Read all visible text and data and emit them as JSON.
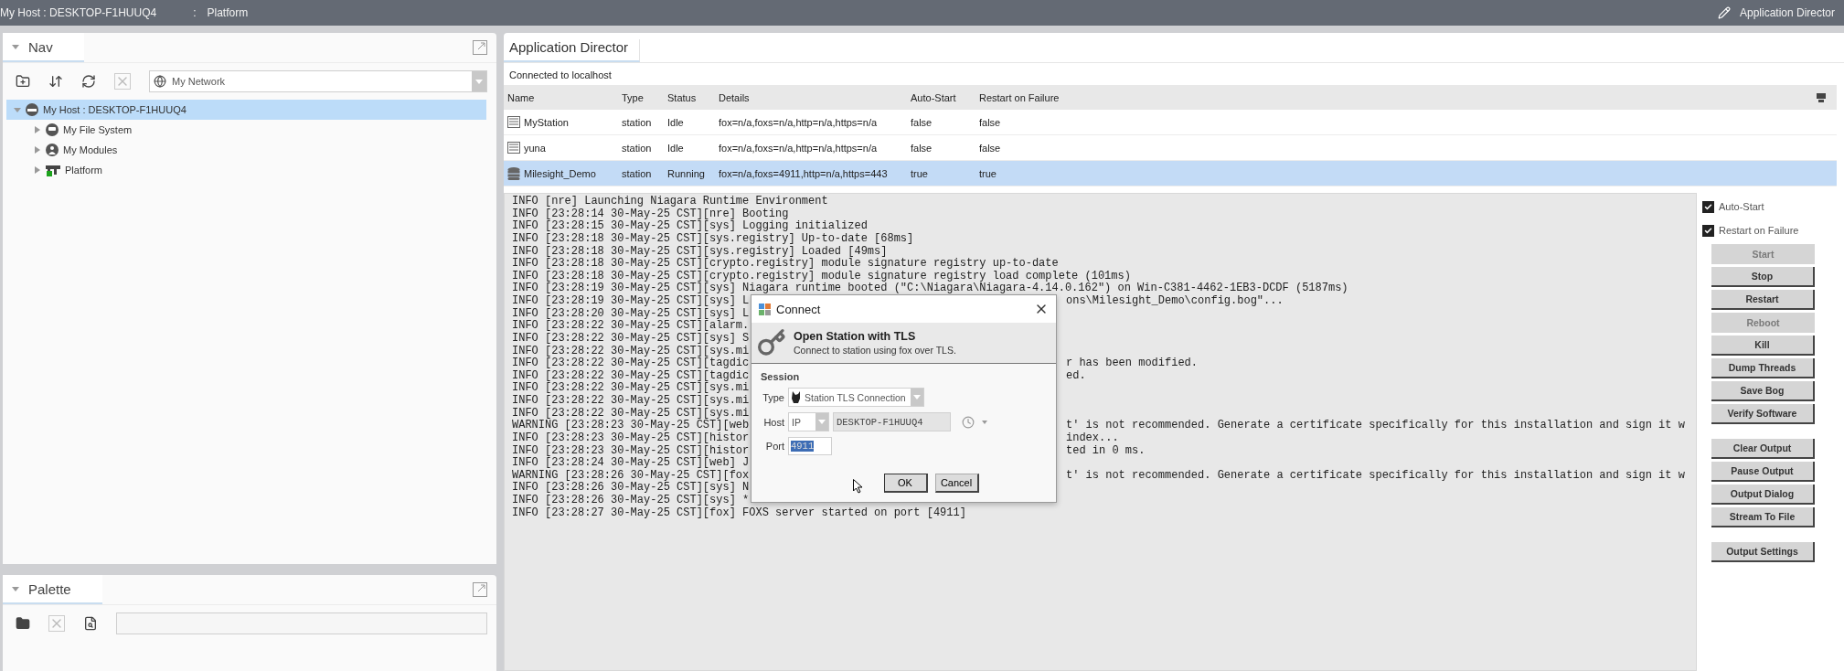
{
  "top_bar": {
    "host": "My Host : DESKTOP-F1HUUQ4",
    "separator": ":",
    "location": "Platform",
    "view": "Application Director"
  },
  "nav": {
    "title": "Nav",
    "network": "My Network",
    "tree": [
      {
        "label": "My Host : DESKTOP-F1HUUQ4",
        "kind": "host",
        "selected": true,
        "expanded": true,
        "children": [
          {
            "label": "My File System",
            "kind": "drive",
            "selected": false,
            "expanded": false
          },
          {
            "label": "My Modules",
            "kind": "modules",
            "selected": false,
            "expanded": false
          },
          {
            "label": "Platform",
            "kind": "platform",
            "selected": false,
            "expanded": false
          }
        ]
      }
    ]
  },
  "palette": {
    "title": "Palette"
  },
  "director": {
    "tab": "Application Director",
    "status": "Connected to localhost",
    "columns": [
      "Name",
      "Type",
      "Status",
      "Details",
      "Auto-Start",
      "Restart on Failure"
    ],
    "rows": [
      {
        "kind": "idle",
        "selected": false,
        "cells": [
          "MyStation",
          "station",
          "Idle",
          "fox=n/a,foxs=n/a,http=n/a,https=n/a",
          "false",
          "false"
        ]
      },
      {
        "kind": "idle",
        "selected": false,
        "cells": [
          "yuna",
          "station",
          "Idle",
          "fox=n/a,foxs=n/a,http=n/a,https=n/a",
          "false",
          "false"
        ]
      },
      {
        "kind": "running",
        "selected": true,
        "cells": [
          "Milesight_Demo",
          "station",
          "Running",
          "fox=n/a,foxs=4911,http=n/a,https=443",
          "true",
          "true"
        ]
      }
    ]
  },
  "log": [
    {
      "left": "INFO [nre] Launching Niagara Runtime Environment"
    },
    {
      "left": "INFO [23:28:14 30-May-25 CST][nre] Booting"
    },
    {
      "left": "INFO [23:28:15 30-May-25 CST][sys] Logging initialized"
    },
    {
      "left": "INFO [23:28:18 30-May-25 CST][sys.registry] Up-to-date [68ms]"
    },
    {
      "left": "INFO [23:28:18 30-May-25 CST][sys.registry] Loaded [49ms]"
    },
    {
      "left": "INFO [23:28:18 30-May-25 CST][crypto.registry] module signature registry up-to-date"
    },
    {
      "left": "INFO [23:28:18 30-May-25 CST][crypto.registry] module signature registry load complete (101ms)"
    },
    {
      "left": "INFO [23:28:19 30-May-25 CST][sys] Niagara runtime booted (\"C:\\Niagara\\Niagara-4.14.0.162\") on Win-C381-4462-1EB3-DCDF (5187ms)"
    },
    {
      "left": "INFO [23:28:19 30-May-25 CST][sys] L",
      "right": "ons\\Milesight_Demo\\config.bog\"..."
    },
    {
      "left": "INFO [23:28:20 30-May-25 CST][sys] L"
    },
    {
      "left": "INFO [23:28:22 30-May-25 CST][alarm."
    },
    {
      "left": "INFO [23:28:22 30-May-25 CST][sys] S"
    },
    {
      "left": "INFO [23:28:22 30-May-25 CST][sys.mi"
    },
    {
      "left": "INFO [23:28:22 30-May-25 CST][tagdic",
      "right": "r has been modified."
    },
    {
      "left": "INFO [23:28:22 30-May-25 CST][tagdic",
      "right": "ed."
    },
    {
      "left": "INFO [23:28:22 30-May-25 CST][sys.mi"
    },
    {
      "left": "INFO [23:28:22 30-May-25 CST][sys.mi"
    },
    {
      "left": "INFO [23:28:22 30-May-25 CST][sys.mi"
    },
    {
      "left": "WARNING [23:28:23 30-May-25 CST][web",
      "right": "t' is not recommended. Generate a certificate specifically for this installation and sign it w"
    },
    {
      "left": "INFO [23:28:23 30-May-25 CST][histor",
      "right": "index..."
    },
    {
      "left": "INFO [23:28:23 30-May-25 CST][histor",
      "right": "ted in 0 ms."
    },
    {
      "left": "INFO [23:28:24 30-May-25 CST][web] J"
    },
    {
      "left": "WARNING [23:28:26 30-May-25 CST][fox",
      "right": "t' is not recommended. Generate a certificate specifically for this installation and sign it w"
    },
    {
      "left": "INFO [23:28:26 30-May-25 CST][sys] N"
    },
    {
      "left": "INFO [23:28:26 30-May-25 CST][sys] *"
    },
    {
      "left": "INFO [23:28:27 30-May-25 CST][fox] FOXS server started on port [4911]"
    }
  ],
  "options": [
    {
      "label": "Auto-Start",
      "checked": true
    },
    {
      "label": "Restart on Failure",
      "checked": true
    }
  ],
  "button_groups": [
    [
      {
        "label": "Start",
        "disabled": true
      },
      {
        "label": "Stop",
        "disabled": false
      },
      {
        "label": "Restart",
        "disabled": false
      },
      {
        "label": "Reboot",
        "disabled": true
      },
      {
        "label": "Kill",
        "disabled": false
      },
      {
        "label": "Dump Threads",
        "disabled": false
      },
      {
        "label": "Save Bog",
        "disabled": false
      },
      {
        "label": "Verify Software",
        "disabled": false
      }
    ],
    [
      {
        "label": "Clear Output",
        "disabled": false
      },
      {
        "label": "Pause Output",
        "disabled": false
      },
      {
        "label": "Output Dialog",
        "disabled": false
      },
      {
        "label": "Stream To File",
        "disabled": false
      }
    ],
    [
      {
        "label": "Output Settings",
        "disabled": false
      }
    ]
  ],
  "dialog": {
    "title": "Connect",
    "heading": "Open Station with TLS",
    "subheading": "Connect to station using fox over TLS.",
    "section": "Session",
    "type_label": "Type",
    "type_value": "Station TLS Connection",
    "host_label": "Host",
    "host_scheme": "IP",
    "host_value": "DESKTOP-F1HUUQ4",
    "port_label": "Port",
    "port_value": "4911",
    "port_selected": true,
    "buttons": [
      {
        "label": "OK",
        "focused": true
      },
      {
        "label": "Cancel",
        "focused": false
      }
    ]
  }
}
